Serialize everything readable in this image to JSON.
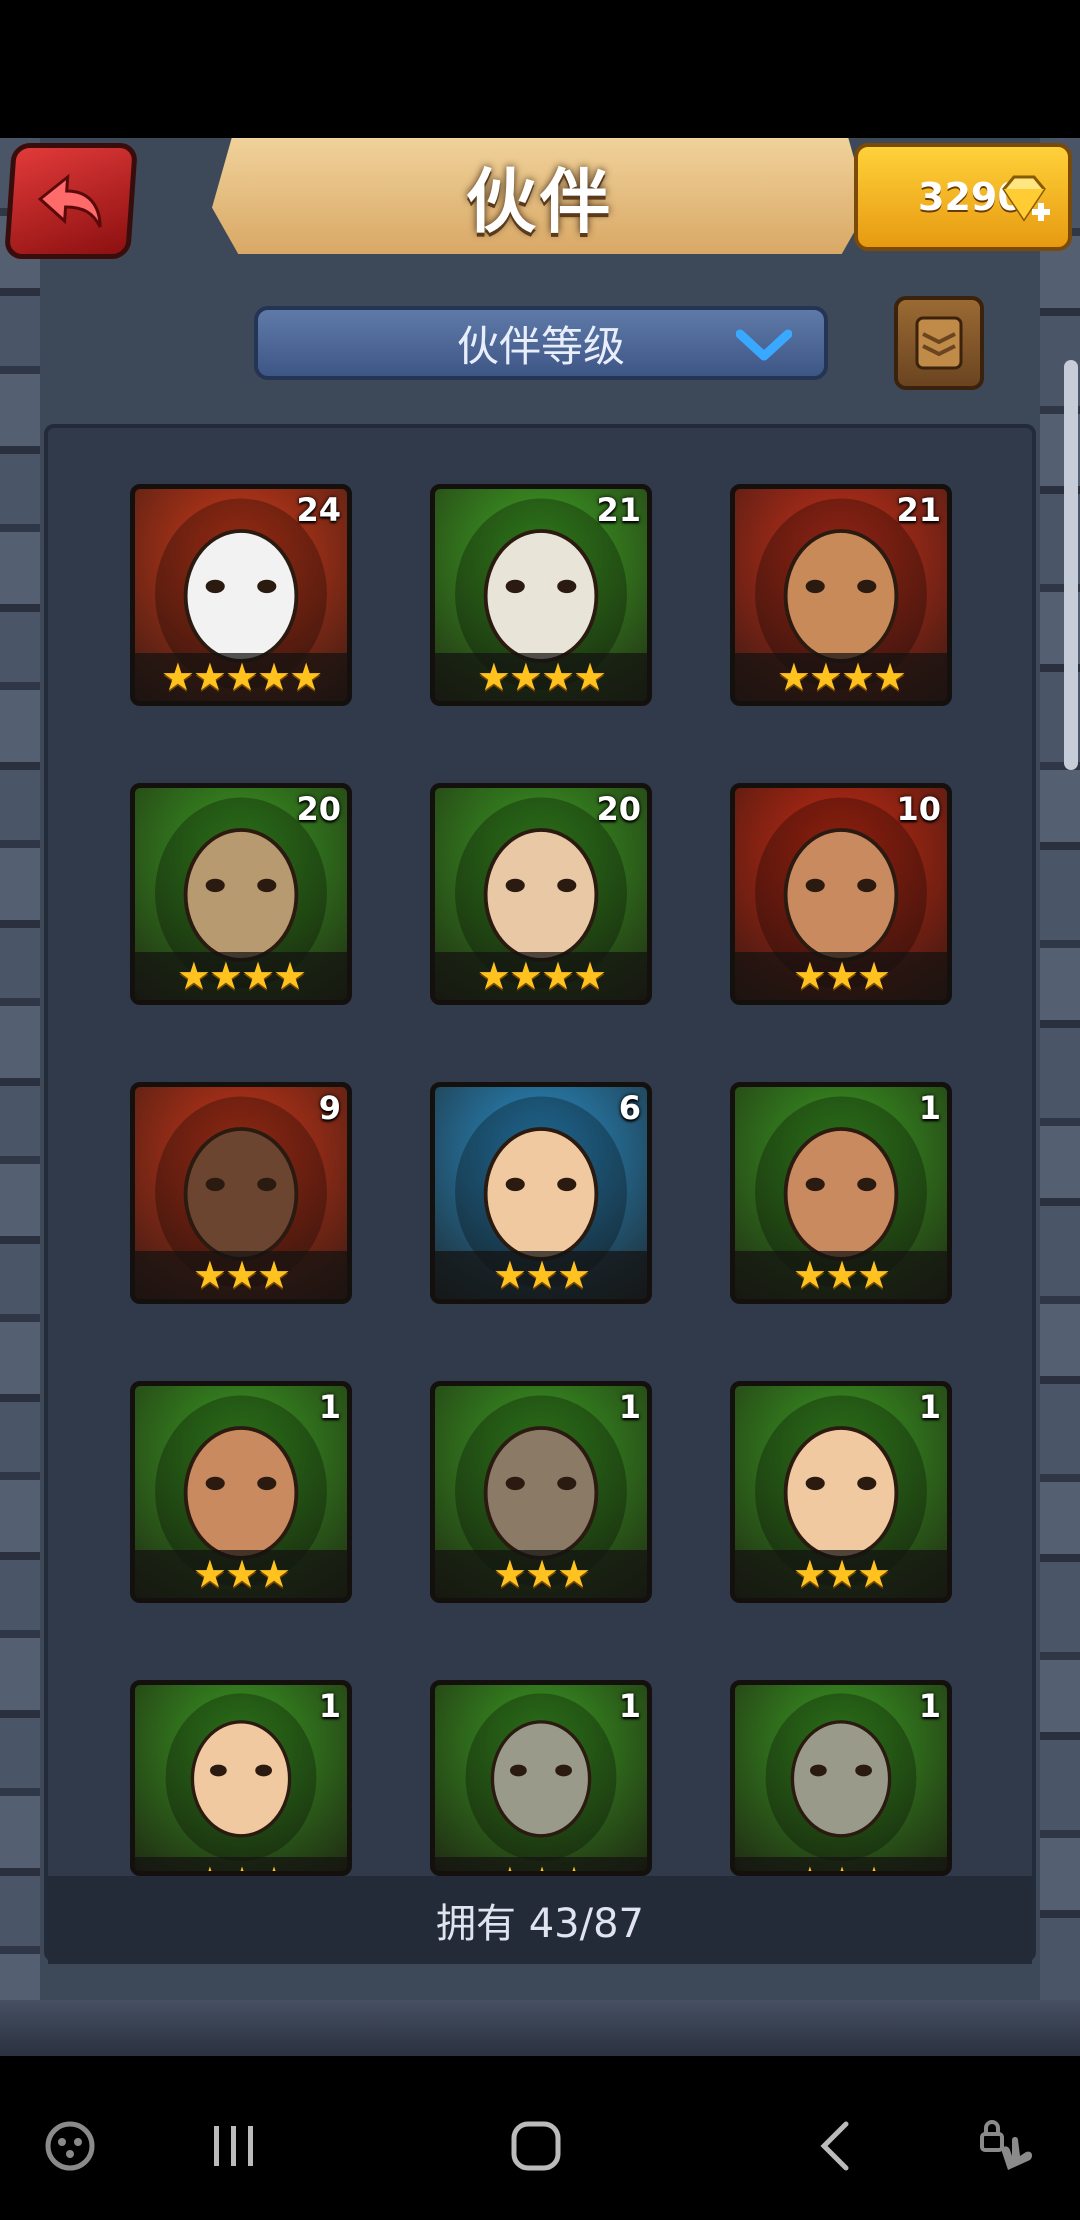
{
  "header": {
    "title": "伙伴",
    "gem_count": "3290"
  },
  "sort": {
    "label": "伙伴等级"
  },
  "heroes": [
    {
      "level": "24",
      "stars": "★★★★★",
      "bg": "#d03a1a",
      "face": "#f2f2f2"
    },
    {
      "level": "21",
      "stars": "★★★★",
      "bg": "#3fa524",
      "face": "#e8e4d8"
    },
    {
      "level": "21",
      "stars": "★★★★",
      "bg": "#c8301a",
      "face": "#c98a5a"
    },
    {
      "level": "20",
      "stars": "★★★★",
      "bg": "#3a9a22",
      "face": "#b89a70"
    },
    {
      "level": "20",
      "stars": "★★★★",
      "bg": "#3a9a22",
      "face": "#e9c9a5"
    },
    {
      "level": "10",
      "stars": "★★★",
      "bg": "#c62a14",
      "face": "#c98a60"
    },
    {
      "level": "9",
      "stars": "★★★",
      "bg": "#c8361a",
      "face": "#6b4530"
    },
    {
      "level": "6",
      "stars": "★★★",
      "bg": "#2a8ec8",
      "face": "#f0c9a0"
    },
    {
      "level": "1",
      "stars": "★★★",
      "bg": "#3a9a22",
      "face": "#c98a60"
    },
    {
      "level": "1",
      "stars": "★★★",
      "bg": "#3a9a22",
      "face": "#c98a60"
    },
    {
      "level": "1",
      "stars": "★★★",
      "bg": "#3a9a22",
      "face": "#8a7a66"
    },
    {
      "level": "1",
      "stars": "★★★",
      "bg": "#3a9a22",
      "face": "#f0c9a0"
    },
    {
      "level": "1",
      "stars": "★★★",
      "bg": "#3a9a22",
      "face": "#f0c9a0"
    },
    {
      "level": "1",
      "stars": "★★★",
      "bg": "#3a9a22",
      "face": "#9a9a8a"
    },
    {
      "level": "1",
      "stars": "★★★",
      "bg": "#3a9a22",
      "face": "#9a9a8a"
    }
  ],
  "footer": {
    "owned_text": "拥有 43/87"
  },
  "nav": {
    "icons": [
      "game-launcher-icon",
      "recent-apps-icon",
      "home-icon",
      "back-icon",
      "touch-lock-icon"
    ]
  },
  "colors": {
    "frame": "#3d4859",
    "panel": "#313a4a",
    "star": "#ffc21f",
    "gem": "#ffd13a"
  }
}
